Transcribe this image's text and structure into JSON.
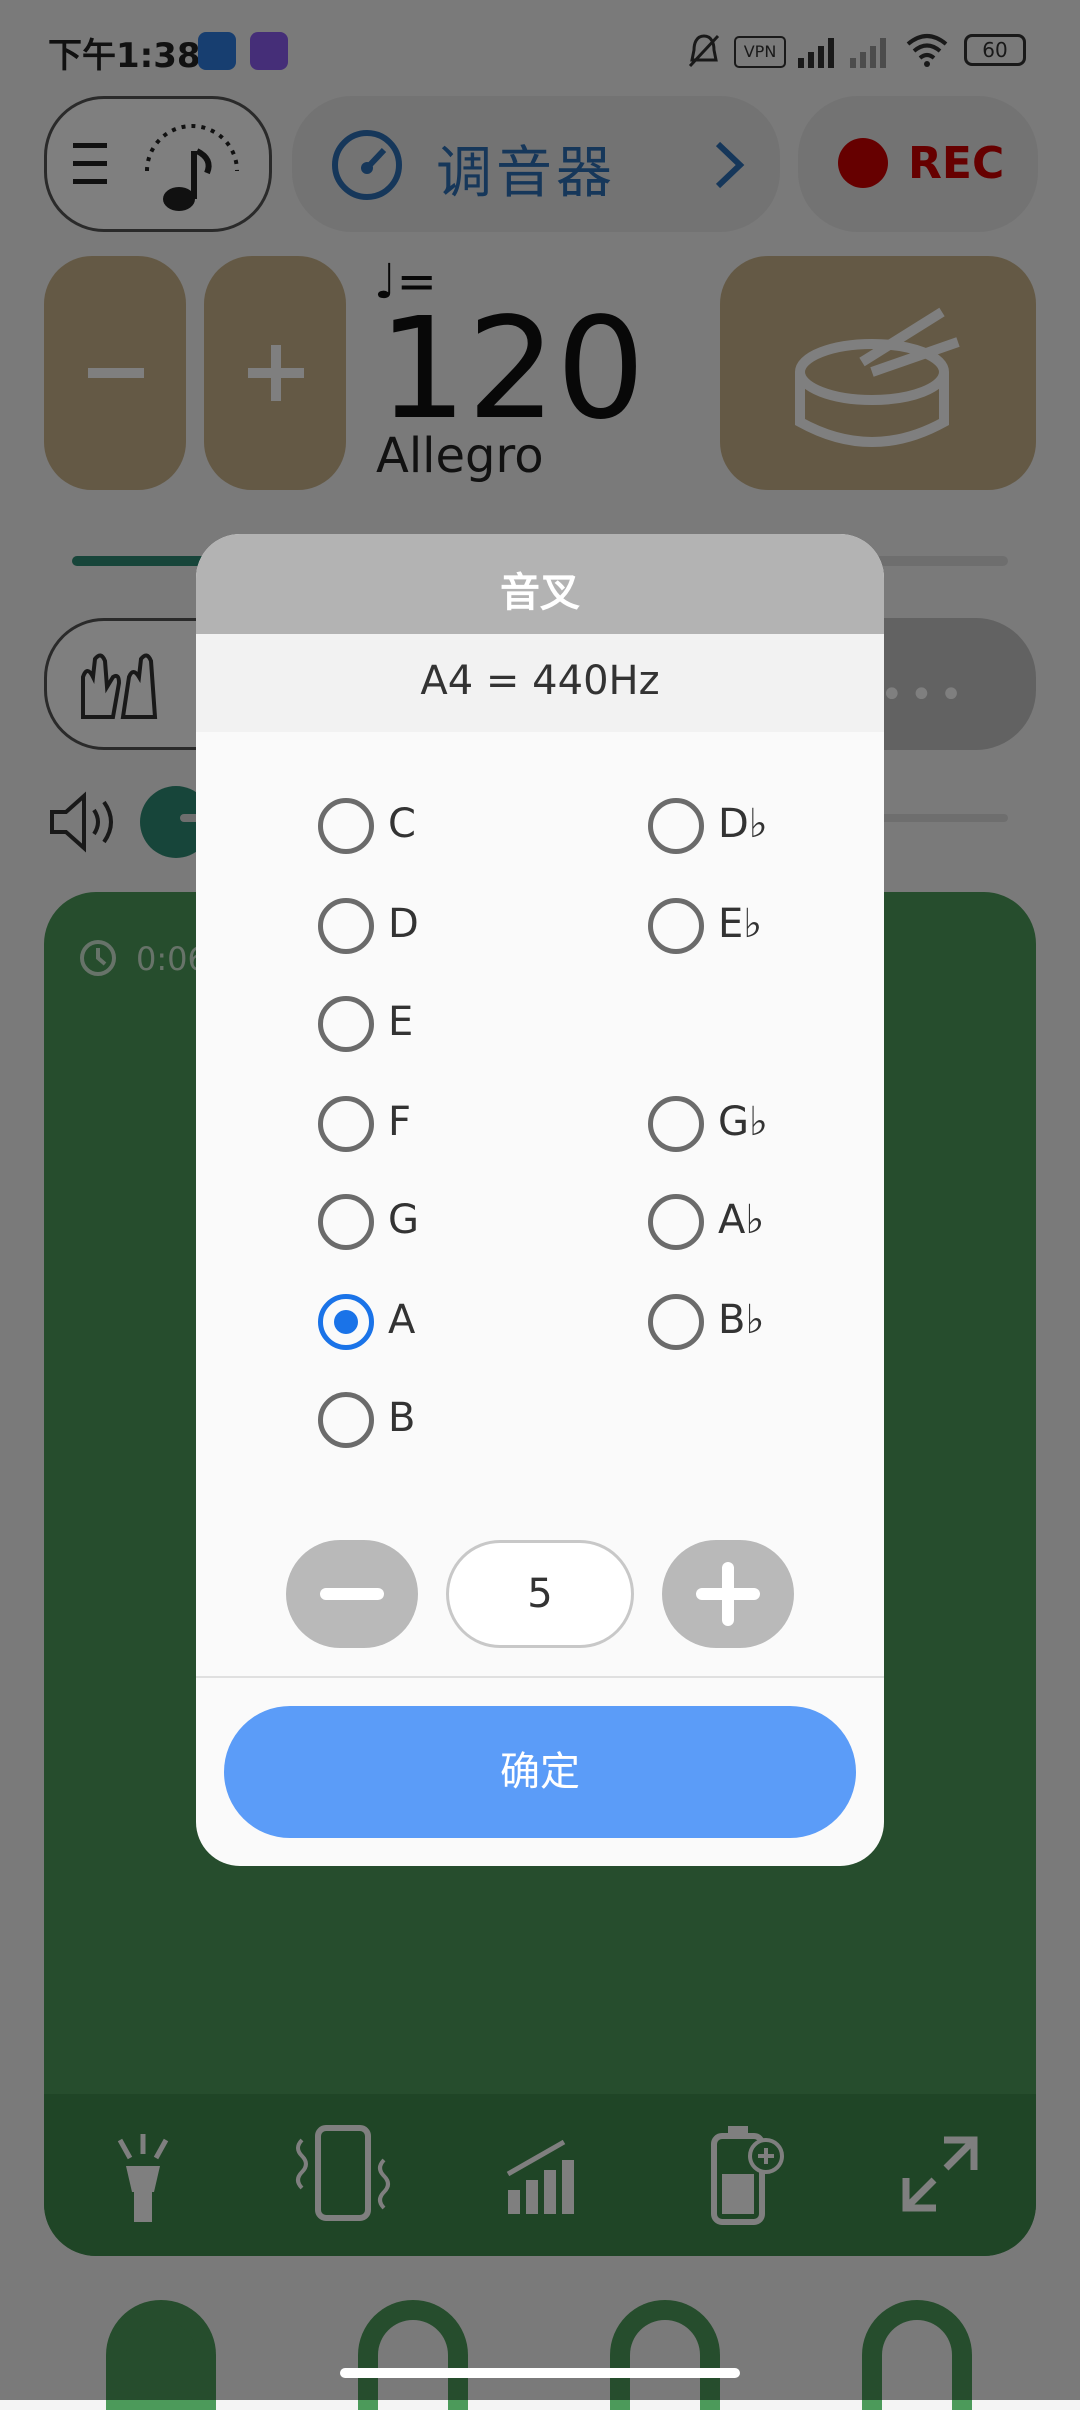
{
  "status_bar": {
    "time": "下午1:38",
    "battery": "60",
    "icons": [
      "bell-muted-icon",
      "vpn-icon",
      "signal-icon",
      "signal-weak-icon",
      "wifi-icon",
      "battery-icon"
    ]
  },
  "header": {
    "tuner_label": "调音器",
    "rec_label": "REC"
  },
  "tempo": {
    "note_eq": "♩=",
    "bpm": "120",
    "name": "Allegro"
  },
  "background_panel": {
    "timer": "0:06"
  },
  "dialog": {
    "title": "音叉",
    "subtitle": "A4 = 440Hz",
    "notes": [
      {
        "label": "C",
        "selected": false
      },
      {
        "label": "D♭",
        "selected": false
      },
      {
        "label": "D",
        "selected": false
      },
      {
        "label": "E♭",
        "selected": false
      },
      {
        "label": "E",
        "selected": false
      },
      {
        "label": "F",
        "selected": false
      },
      {
        "label": "G♭",
        "selected": false
      },
      {
        "label": "G",
        "selected": false
      },
      {
        "label": "A♭",
        "selected": false
      },
      {
        "label": "A",
        "selected": true
      },
      {
        "label": "B♭",
        "selected": false
      },
      {
        "label": "B",
        "selected": false
      }
    ],
    "octave_value": "5",
    "confirm_label": "确定"
  },
  "colors": {
    "accent_blue": "#1a73e8",
    "confirm_button": "#5b9cf8",
    "panel_green": "#4c9a5a"
  }
}
